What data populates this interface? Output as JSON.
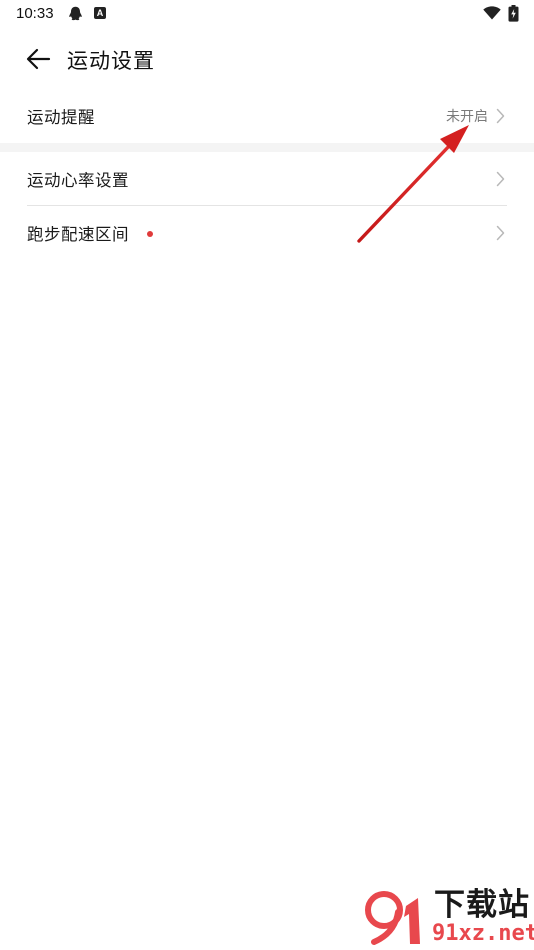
{
  "status_bar": {
    "time": "10:33",
    "icons": [
      "qq-icon",
      "a-notification-icon",
      "wifi-icon",
      "battery-charging-icon"
    ],
    "a_badge": "A"
  },
  "header": {
    "back_icon": "arrow-left-icon",
    "title": "运动设置"
  },
  "settings": {
    "items": [
      {
        "label": "运动提醒",
        "value": "未开启",
        "icon": "chevron-right-icon"
      },
      {
        "label": "运动心率设置",
        "icon": "chevron-right-icon"
      },
      {
        "label": "跑步配速区间",
        "badge": "new-dot",
        "icon": "chevron-right-icon"
      }
    ]
  },
  "annotation": {
    "type": "red-arrow",
    "color": "#d42020",
    "points_to": "运动提醒"
  },
  "watermark": {
    "title": "下载站",
    "domain": "91xz.net",
    "colors": {
      "accent": "#e8484d",
      "text": "#1a1a1a"
    }
  },
  "colors": {
    "background": "#ffffff",
    "section_gap": "#f4f4f4",
    "secondary_text": "#7a7a7a",
    "dot": "#e03a3a"
  }
}
